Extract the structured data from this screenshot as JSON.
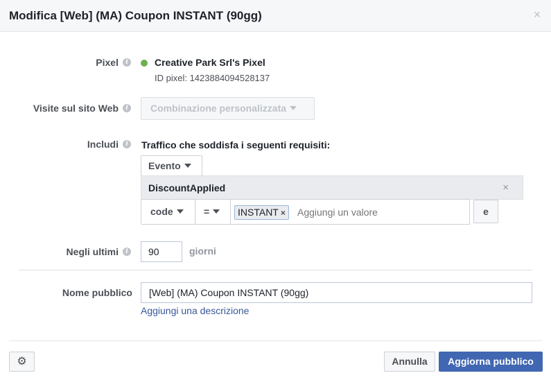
{
  "dialog": {
    "title": "Modifica [Web] (MA) Coupon INSTANT (90gg)",
    "close_icon": "×"
  },
  "pixel": {
    "label": "Pixel",
    "name": "Creative Park Srl's Pixel",
    "id_text": "ID pixel: 1423884094528137",
    "status_color": "#6ab04c"
  },
  "website_visits": {
    "label": "Visite sul sito Web",
    "selected": "Combinazione personalizzata"
  },
  "include": {
    "label": "Includi",
    "traffic_text": "Traffico che soddisfa i seguenti requisiti:",
    "type_dropdown": "Evento",
    "event_name": "DiscountApplied",
    "rule": {
      "parameter": "code",
      "operator": "=",
      "token": "INSTANT",
      "value_placeholder": "Aggiungi un valore",
      "and_button": "e"
    }
  },
  "retention": {
    "label": "Negli ultimi",
    "value": "90",
    "unit": "giorni"
  },
  "audience_name": {
    "label": "Nome pubblico",
    "value": "[Web] (MA) Coupon INSTANT (90gg)",
    "add_description": "Aggiungi una descrizione"
  },
  "footer": {
    "cancel": "Annulla",
    "update": "Aggiorna pubblico"
  },
  "icons": {
    "info": "i",
    "gear": "⚙",
    "remove": "×"
  },
  "colors": {
    "primary": "#4267b2",
    "link": "#365899",
    "status_active": "#6ab04c"
  }
}
